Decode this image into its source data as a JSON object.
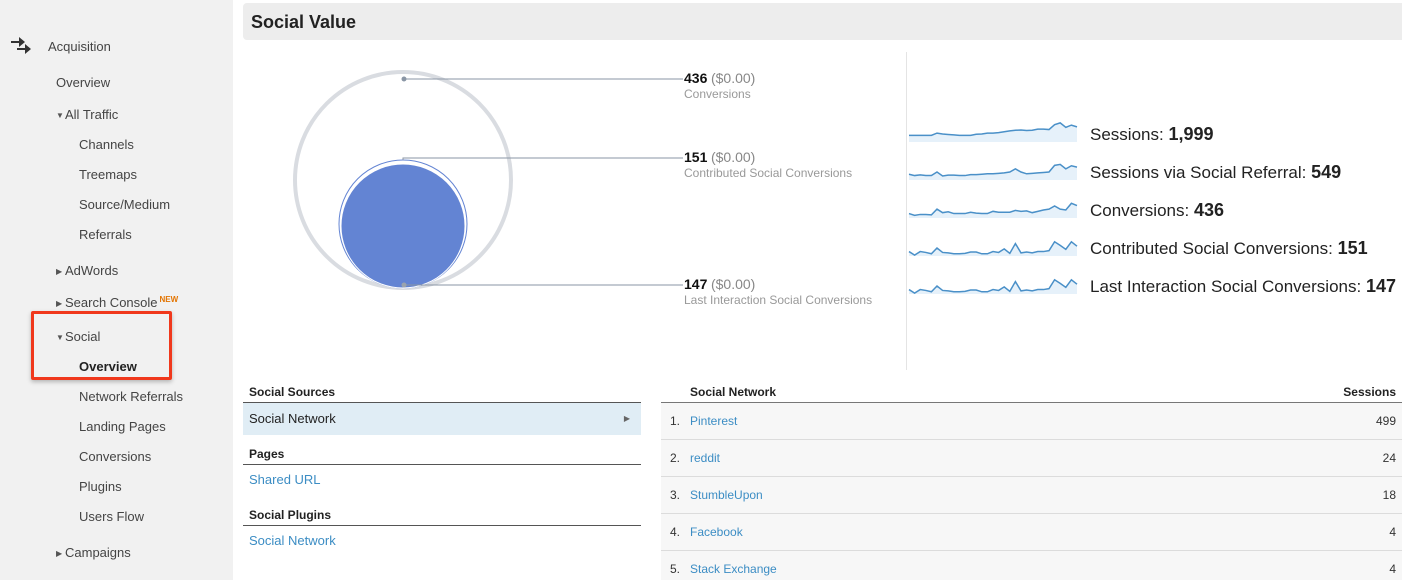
{
  "sidebar": {
    "section": "Acquisition",
    "section_icon": "acquisition-arrows-icon",
    "items": [
      {
        "label": "Overview",
        "level": 1
      },
      {
        "label": "All Traffic",
        "level": 1,
        "expander": "expanded"
      },
      {
        "label": "Channels",
        "level": 2
      },
      {
        "label": "Treemaps",
        "level": 2
      },
      {
        "label": "Source/Medium",
        "level": 2
      },
      {
        "label": "Referrals",
        "level": 2
      },
      {
        "label": "AdWords",
        "level": 1,
        "expander": "collapsed"
      },
      {
        "label": "Search Console",
        "level": 1,
        "expander": "collapsed",
        "badge": "NEW"
      },
      {
        "label": "Social",
        "level": 1,
        "expander": "expanded"
      },
      {
        "label": "Overview",
        "level": 2,
        "active": true
      },
      {
        "label": "Network Referrals",
        "level": 2
      },
      {
        "label": "Landing Pages",
        "level": 2
      },
      {
        "label": "Conversions",
        "level": 2
      },
      {
        "label": "Plugins",
        "level": 2
      },
      {
        "label": "Users Flow",
        "level": 2
      },
      {
        "label": "Campaigns",
        "level": 1,
        "expander": "collapsed"
      }
    ]
  },
  "header": {
    "title": "Social Value"
  },
  "conversions": [
    {
      "num": "436",
      "value": "($0.00)",
      "label": "Conversions"
    },
    {
      "num": "151",
      "value": "($0.00)",
      "label": "Contributed Social Conversions"
    },
    {
      "num": "147",
      "value": "($0.00)",
      "label": "Last Interaction Social Conversions"
    }
  ],
  "metrics": [
    {
      "label": "Sessions:",
      "value": "1,999",
      "trend": [
        5,
        5,
        5,
        5,
        5,
        6,
        5.6,
        5.4,
        5.2,
        5,
        5,
        5,
        5.5,
        5.6,
        6,
        6,
        6.2,
        6.6,
        7,
        7.3,
        7.4,
        7.2,
        7.3,
        7.8,
        7.8,
        7.6,
        9.8,
        10.6,
        8.6,
        9.6,
        8.8
      ]
    },
    {
      "label": "Sessions via Social Referral:",
      "value": "549",
      "trend": [
        4.6,
        4,
        4.3,
        4,
        4,
        5.6,
        3.8,
        4.2,
        4.2,
        4,
        4,
        4.4,
        4.4,
        4.6,
        4.8,
        4.8,
        5,
        5.2,
        5.6,
        7,
        5.6,
        4.8,
        5,
        5.2,
        5.4,
        5.6,
        8.6,
        9,
        7,
        8.4,
        7.8
      ]
    },
    {
      "label": "Conversions:",
      "value": "436",
      "trend": [
        4,
        3.2,
        3.6,
        3.6,
        3.4,
        6,
        4.4,
        4.8,
        4,
        4,
        4,
        4.6,
        4.2,
        4,
        4,
        5,
        4.6,
        4.6,
        4.6,
        5.4,
        5,
        5.2,
        4.4,
        5,
        5.6,
        6,
        7.4,
        6,
        5.6,
        8.6,
        7.6
      ]
    },
    {
      "label": "Contributed Social Conversions:",
      "value": "151",
      "trend": [
        4,
        2.4,
        4,
        3.6,
        3,
        5.6,
        3.6,
        3.4,
        3,
        3,
        3.2,
        3.8,
        3.8,
        3,
        3,
        4,
        3.6,
        5.2,
        3.2,
        7.6,
        3.4,
        3.8,
        3.4,
        4,
        4,
        4.4,
        8.4,
        6.8,
        5,
        8.4,
        6.4
      ]
    },
    {
      "label": "Last Interaction Social Conversions:",
      "value": "147",
      "trend": [
        4,
        2.4,
        4,
        3.6,
        3,
        5.6,
        3.6,
        3.4,
        3,
        3,
        3.2,
        3.8,
        3.8,
        3,
        3,
        4,
        3.6,
        5.2,
        3.2,
        7.6,
        3.4,
        3.8,
        3.4,
        4,
        4,
        4.4,
        8.4,
        6.8,
        5,
        8.4,
        6.4
      ]
    }
  ],
  "social_sources": {
    "heading": "Social Sources",
    "selected": "Social Network",
    "pages_heading": "Pages",
    "pages_link": "Shared URL",
    "plugins_heading": "Social Plugins",
    "plugins_link": "Social Network"
  },
  "network_table": {
    "col_name": "Social Network",
    "col_sessions": "Sessions",
    "rows": [
      {
        "idx": "1.",
        "name": "Pinterest",
        "sessions": "499"
      },
      {
        "idx": "2.",
        "name": "reddit",
        "sessions": "24"
      },
      {
        "idx": "3.",
        "name": "StumbleUpon",
        "sessions": "18"
      },
      {
        "idx": "4.",
        "name": "Facebook",
        "sessions": "4"
      },
      {
        "idx": "5.",
        "name": "Stack Exchange",
        "sessions": "4"
      }
    ]
  },
  "colors": {
    "accent_blue": "#6384d3",
    "link": "#3c8dc4",
    "sparkline": "#4a90c8",
    "highlight_red": "#f0381c",
    "new_badge": "#e37400"
  }
}
